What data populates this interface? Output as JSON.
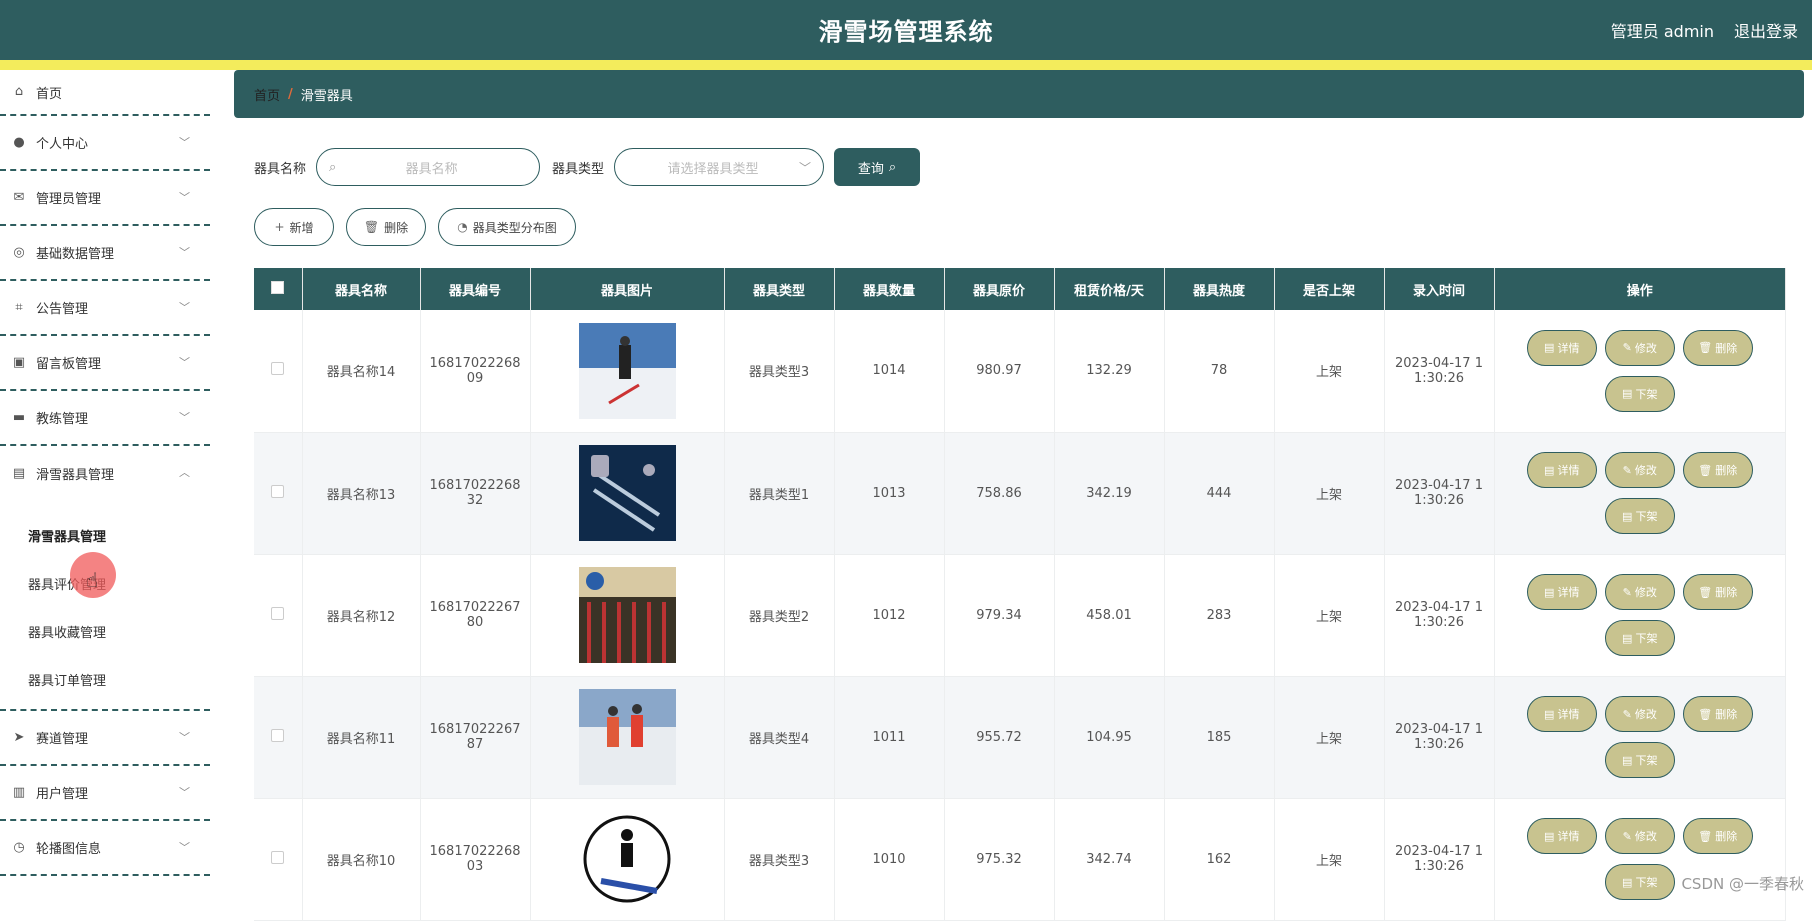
{
  "header": {
    "title": "滑雪场管理系统",
    "user": "管理员 admin",
    "logout": "退出登录"
  },
  "sidebar": {
    "items": [
      {
        "label": "首页",
        "icon": "home-icon"
      },
      {
        "label": "个人中心",
        "icon": "user-icon"
      },
      {
        "label": "管理员管理",
        "icon": "mail-icon"
      },
      {
        "label": "基础数据管理",
        "icon": "compass-icon"
      },
      {
        "label": "公告管理",
        "icon": "crop-icon"
      },
      {
        "label": "留言板管理",
        "icon": "briefcase-icon"
      },
      {
        "label": "教练管理",
        "icon": "ticket-icon"
      },
      {
        "label": "滑雪器具管理",
        "icon": "printer-icon"
      },
      {
        "label": "赛道管理",
        "icon": "send-icon"
      },
      {
        "label": "用户管理",
        "icon": "clipboard-icon"
      },
      {
        "label": "轮播图信息",
        "icon": "clock-icon"
      }
    ],
    "sub_items": [
      "滑雪器具管理",
      "器具评价管理",
      "器具收藏管理",
      "器具订单管理"
    ]
  },
  "breadcrumb": {
    "home": "首页",
    "sep": "/",
    "current": "滑雪器具"
  },
  "search": {
    "name_label": "器具名称",
    "name_placeholder": "器具名称",
    "type_label": "器具类型",
    "type_placeholder": "请选择器具类型",
    "query": "查询"
  },
  "actions": {
    "add": "新增",
    "delete": "删除",
    "chart": "器具类型分布图"
  },
  "table": {
    "headers": [
      "器具名称",
      "器具编号",
      "器具图片",
      "器具类型",
      "器具数量",
      "器具原价",
      "租赁价格/天",
      "器具热度",
      "是否上架",
      "录入时间",
      "操作"
    ],
    "rows": [
      {
        "name": "器具名称14",
        "code": "16817022268 09",
        "type": "器具类型3",
        "qty": "1014",
        "price": "980.97",
        "rent": "132.29",
        "heat": "78",
        "shelf": "上架",
        "time": "2023-04-17 1 1:30:26"
      },
      {
        "name": "器具名称13",
        "code": "16817022268 32",
        "type": "器具类型1",
        "qty": "1013",
        "price": "758.86",
        "rent": "342.19",
        "heat": "444",
        "shelf": "上架",
        "time": "2023-04-17 1 1:30:26"
      },
      {
        "name": "器具名称12",
        "code": "16817022267 80",
        "type": "器具类型2",
        "qty": "1012",
        "price": "979.34",
        "rent": "458.01",
        "heat": "283",
        "shelf": "上架",
        "time": "2023-04-17 1 1:30:26"
      },
      {
        "name": "器具名称11",
        "code": "16817022267 87",
        "type": "器具类型4",
        "qty": "1011",
        "price": "955.72",
        "rent": "104.95",
        "heat": "185",
        "shelf": "上架",
        "time": "2023-04-17 1 1:30:26"
      },
      {
        "name": "器具名称10",
        "code": "16817022268 03",
        "type": "器具类型3",
        "qty": "1010",
        "price": "975.32",
        "rent": "342.74",
        "heat": "162",
        "shelf": "上架",
        "time": "2023-04-17 1 1:30:26"
      }
    ],
    "ops": {
      "detail": "详情",
      "edit": "修改",
      "delete": "删除",
      "unshelf": "下架"
    }
  },
  "watermark": "CSDN @一季春秋",
  "colors": {
    "primary": "#2e5d5f",
    "accent": "#f3ec5c",
    "op_button": "#c8c38f"
  }
}
